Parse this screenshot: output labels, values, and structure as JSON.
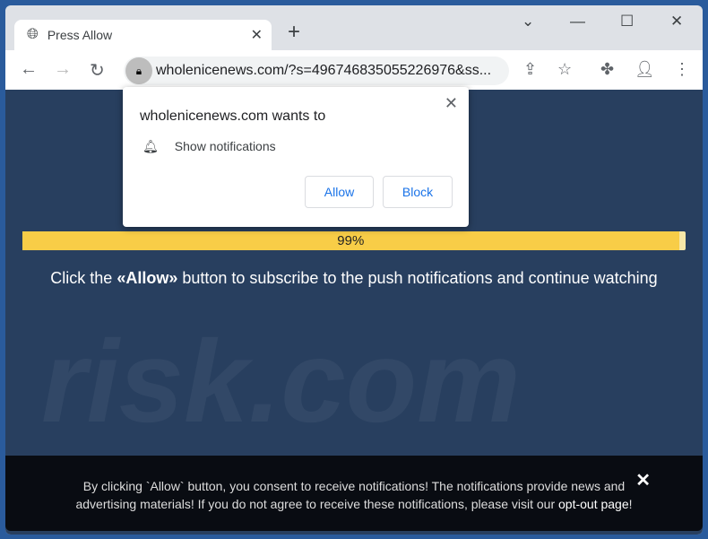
{
  "tab": {
    "title": "Press Allow",
    "icon": "globe-icon"
  },
  "address": {
    "url": "wholenicenews.com/?s=496746835055226976&ss..."
  },
  "popup": {
    "heading": "wholenicenews.com wants to",
    "permission": "Show notifications",
    "allow": "Allow",
    "block": "Block"
  },
  "progress": {
    "label": "99%",
    "value": 99
  },
  "main": {
    "pre": "Click the ",
    "bold": "«Allow»",
    "post": " button to subscribe to the push notifications and continue watching"
  },
  "watermark": "risk.com",
  "footer": {
    "line1": "By clicking `Allow` button, you consent to receive notifications! The notifications provide news and",
    "line2": "advertising materials! If you do not agree to receive these notifications, please visit our ",
    "link": "opt-out page",
    "end": "!"
  },
  "colors": {
    "progress": "#f8cd47",
    "page": "#283f5f"
  }
}
